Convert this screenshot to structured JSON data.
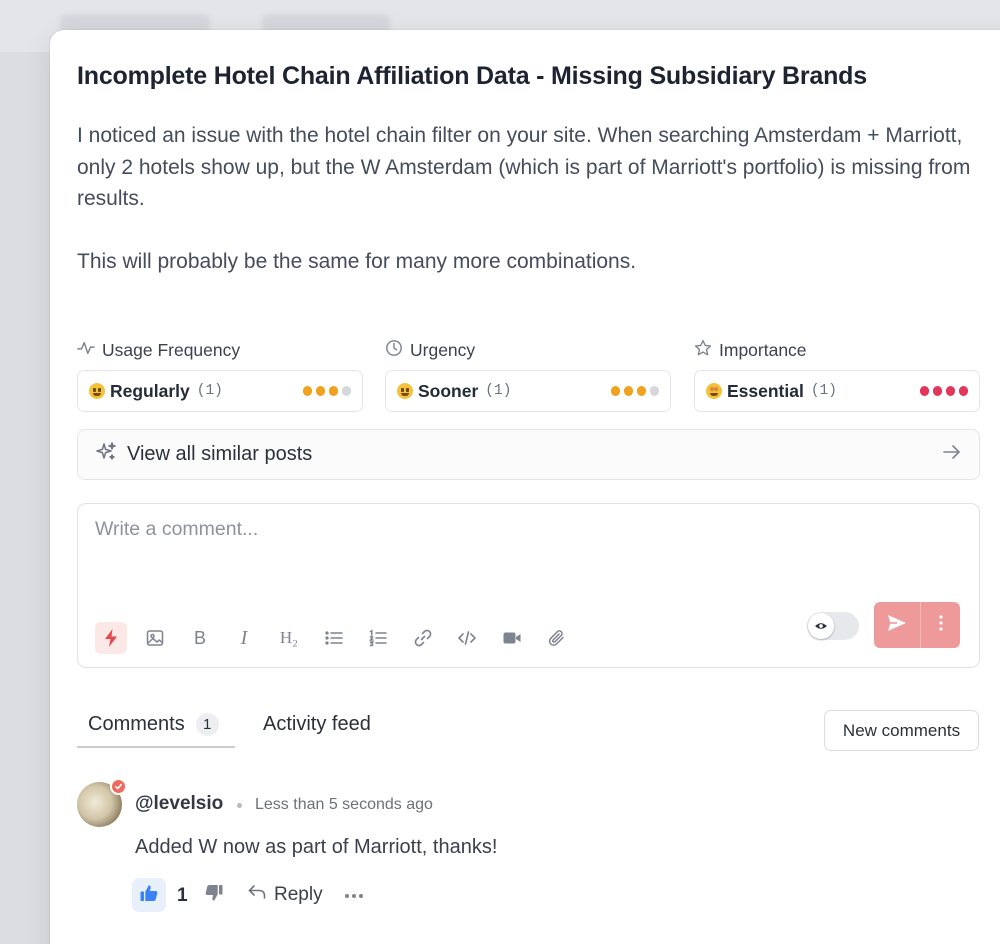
{
  "post": {
    "title": "Incomplete Hotel Chain Affiliation Data - Missing Subsidiary Brands",
    "paragraphs": [
      "I noticed an issue with the hotel chain filter on your site. When searching Amsterdam + Marriott, only 2 hotels show up, but the W Amsterdam (which is part of Marriott's portfolio) is missing from results.",
      "This will probably be the same for many more combinations."
    ]
  },
  "metrics": [
    {
      "heading": "Usage Frequency",
      "icon": "activity-icon",
      "emoji": "grinning-emoji",
      "value": "Regularly",
      "count": "(1)",
      "level": 3,
      "max": 4,
      "color": "#f0a21f"
    },
    {
      "heading": "Urgency",
      "icon": "clock-icon",
      "emoji": "grinning-emoji",
      "value": "Sooner",
      "count": "(1)",
      "level": 3,
      "max": 4,
      "color": "#f0a21f"
    },
    {
      "heading": "Importance",
      "icon": "star-icon",
      "emoji": "star-struck-emoji",
      "value": "Essential",
      "count": "(1)",
      "level": 4,
      "max": 4,
      "color": "#e2365b"
    }
  ],
  "similar": {
    "label": "View all similar posts"
  },
  "composer": {
    "placeholder": "Write a comment...",
    "tools": [
      "bolt-icon",
      "image-icon",
      "bold-icon",
      "italic-icon",
      "heading-2-icon",
      "bullet-list-icon",
      "numbered-list-icon",
      "link-icon",
      "code-icon",
      "video-icon",
      "attachment-icon"
    ],
    "tool_glyphs": {
      "bold": "B",
      "italic": "I",
      "heading": "H₂"
    },
    "accent": "#ee9a9a"
  },
  "tabs": [
    {
      "label": "Comments",
      "badge": "1",
      "active": true
    },
    {
      "label": "Activity feed",
      "active": false
    }
  ],
  "new_comments_label": "New comments",
  "comment": {
    "username": "@levelsio",
    "timestamp": "Less than 5 seconds ago",
    "text": "Added W now as part of Marriott, thanks!",
    "likes": "1",
    "reply_label": "Reply"
  }
}
